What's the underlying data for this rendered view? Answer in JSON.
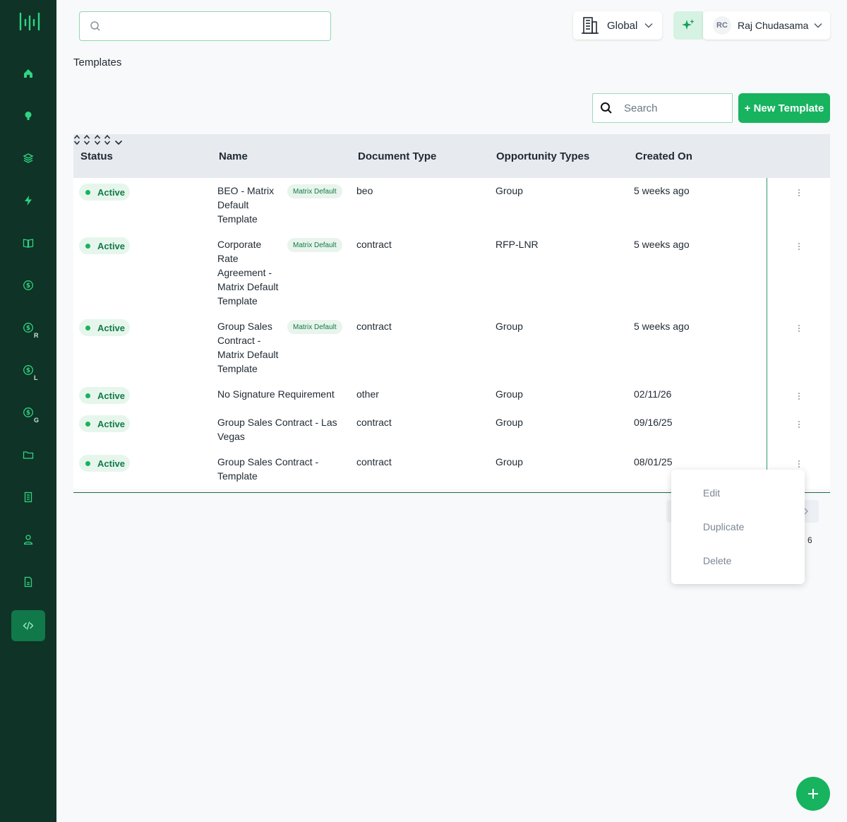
{
  "header": {
    "search_placeholder": "",
    "scope_label": "Global",
    "user_initials": "RC",
    "user_name": "Raj Chudasama"
  },
  "breadcrumb": "Templates",
  "toolbar": {
    "search_placeholder": "Search",
    "new_button": "+ New Template"
  },
  "sidebar": {
    "items": [
      {
        "icon": "home-icon"
      },
      {
        "icon": "lightbulb-icon"
      },
      {
        "icon": "layers-icon"
      },
      {
        "icon": "lightning-icon"
      },
      {
        "icon": "book-icon"
      },
      {
        "icon": "dollar-icon"
      },
      {
        "icon": "dollar-icon",
        "sub": "R"
      },
      {
        "icon": "dollar-icon",
        "sub": "L"
      },
      {
        "icon": "dollar-icon",
        "sub": "G"
      },
      {
        "icon": "folder-icon"
      },
      {
        "icon": "building-icon"
      },
      {
        "icon": "user-icon"
      },
      {
        "icon": "document-icon"
      },
      {
        "icon": "code-icon",
        "active": true
      }
    ]
  },
  "table": {
    "columns": [
      "Status",
      "Name",
      "Document Type",
      "Opportunity Types",
      "Created On"
    ],
    "rows": [
      {
        "status": "Active",
        "name": [
          "BEO - Matrix",
          "Default",
          "Template"
        ],
        "badge": "Matrix Default",
        "doc_type": "beo",
        "opp_type": "Group",
        "created": "5 weeks ago"
      },
      {
        "status": "Active",
        "name": [
          "Corporate",
          "Rate",
          "Agreement -",
          "Matrix Default",
          "Template"
        ],
        "badge": "Matrix Default",
        "doc_type": "contract",
        "opp_type": "RFP-LNR",
        "created": "5 weeks ago"
      },
      {
        "status": "Active",
        "name": [
          "Group Sales",
          "Contract -",
          "Matrix Default",
          "Template"
        ],
        "badge": "Matrix Default",
        "doc_type": "contract",
        "opp_type": "Group",
        "created": "5 weeks ago"
      },
      {
        "status": "Active",
        "name": [
          "No Signature Requirement"
        ],
        "badge": "",
        "doc_type": "other",
        "opp_type": "Group",
        "created": "02/11/26"
      },
      {
        "status": "Active",
        "name": [
          "Group Sales Contract - Las",
          "Vegas"
        ],
        "badge": "",
        "doc_type": "contract",
        "opp_type": "Group",
        "created": "09/16/25"
      },
      {
        "status": "Active",
        "name": [
          "Group Sales Contract -",
          "Template"
        ],
        "badge": "",
        "doc_type": "contract",
        "opp_type": "Group",
        "created": "08/01/25"
      }
    ]
  },
  "pagination": {
    "count": "6"
  },
  "row_menu": {
    "items": [
      "Edit",
      "Duplicate",
      "Delete"
    ]
  },
  "colors": {
    "accent": "#17b35f",
    "sidebar": "#0f3326"
  }
}
